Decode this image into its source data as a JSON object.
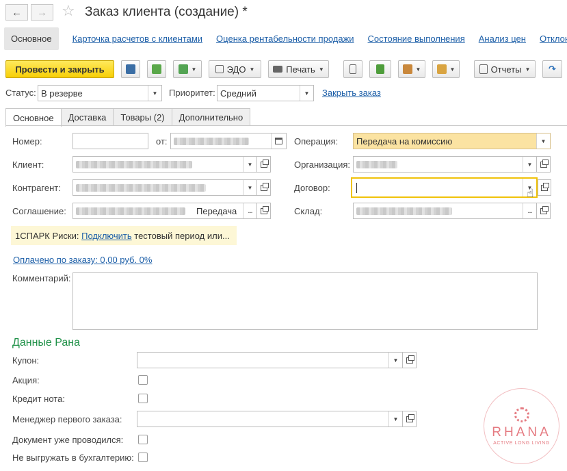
{
  "window": {
    "title": "Заказ клиента (создание) *"
  },
  "nav": {
    "links": [
      "Основное",
      "Карточка расчетов с клиентами",
      "Оценка рентабельности продажи",
      "Состояние выполнения",
      "Анализ цен",
      "Отклонени"
    ]
  },
  "toolbar": {
    "post_close": "Провести и закрыть",
    "edo": "ЭДО",
    "print": "Печать",
    "reports": "Отчеты"
  },
  "status_bar": {
    "status_label": "Статус:",
    "status_value": "В резерве",
    "priority_label": "Приоритет:",
    "priority_value": "Средний",
    "close_order": "Закрыть заказ"
  },
  "tabs": [
    "Основное",
    "Доставка",
    "Товары (2)",
    "Дополнительно"
  ],
  "form": {
    "number_label": "Номер:",
    "number_value": "",
    "date_label": "от:",
    "operation_label": "Операция:",
    "operation_value": "Передача на комиссию",
    "client_label": "Клиент:",
    "org_label": "Организация:",
    "counterparty_label": "Контрагент:",
    "contract_label": "Договор:",
    "contract_value": "",
    "agreement_label": "Соглашение:",
    "agreement_suffix": "Передача",
    "warehouse_label": "Склад:",
    "spark_prefix": "1СПАРК Риски:",
    "spark_link": "Подключить",
    "spark_suffix": "тестовый период или...",
    "paid_link": "Оплачено по заказу: 0,00 руб. 0%",
    "comment_label": "Комментарий:",
    "comment_value": ""
  },
  "rana": {
    "section_title": "Данные Рана",
    "coupon_label": "Купон:",
    "promo_label": "Акция:",
    "credit_label": "Кредит нота:",
    "manager_label": "Менеджер первого заказа:",
    "posted_label": "Документ уже проводился:",
    "no_export_label": "Не выгружать в бухгалтерию:"
  },
  "watermark": {
    "name": "RHANA",
    "tagline": "ACTIVE LONG LIVING"
  },
  "colors": {
    "primary_button": "#f7cf07",
    "link": "#1d5fa8",
    "section": "#1f9148",
    "focus_border": "#f0c20a",
    "operation_bg": "#fbe3a2"
  }
}
